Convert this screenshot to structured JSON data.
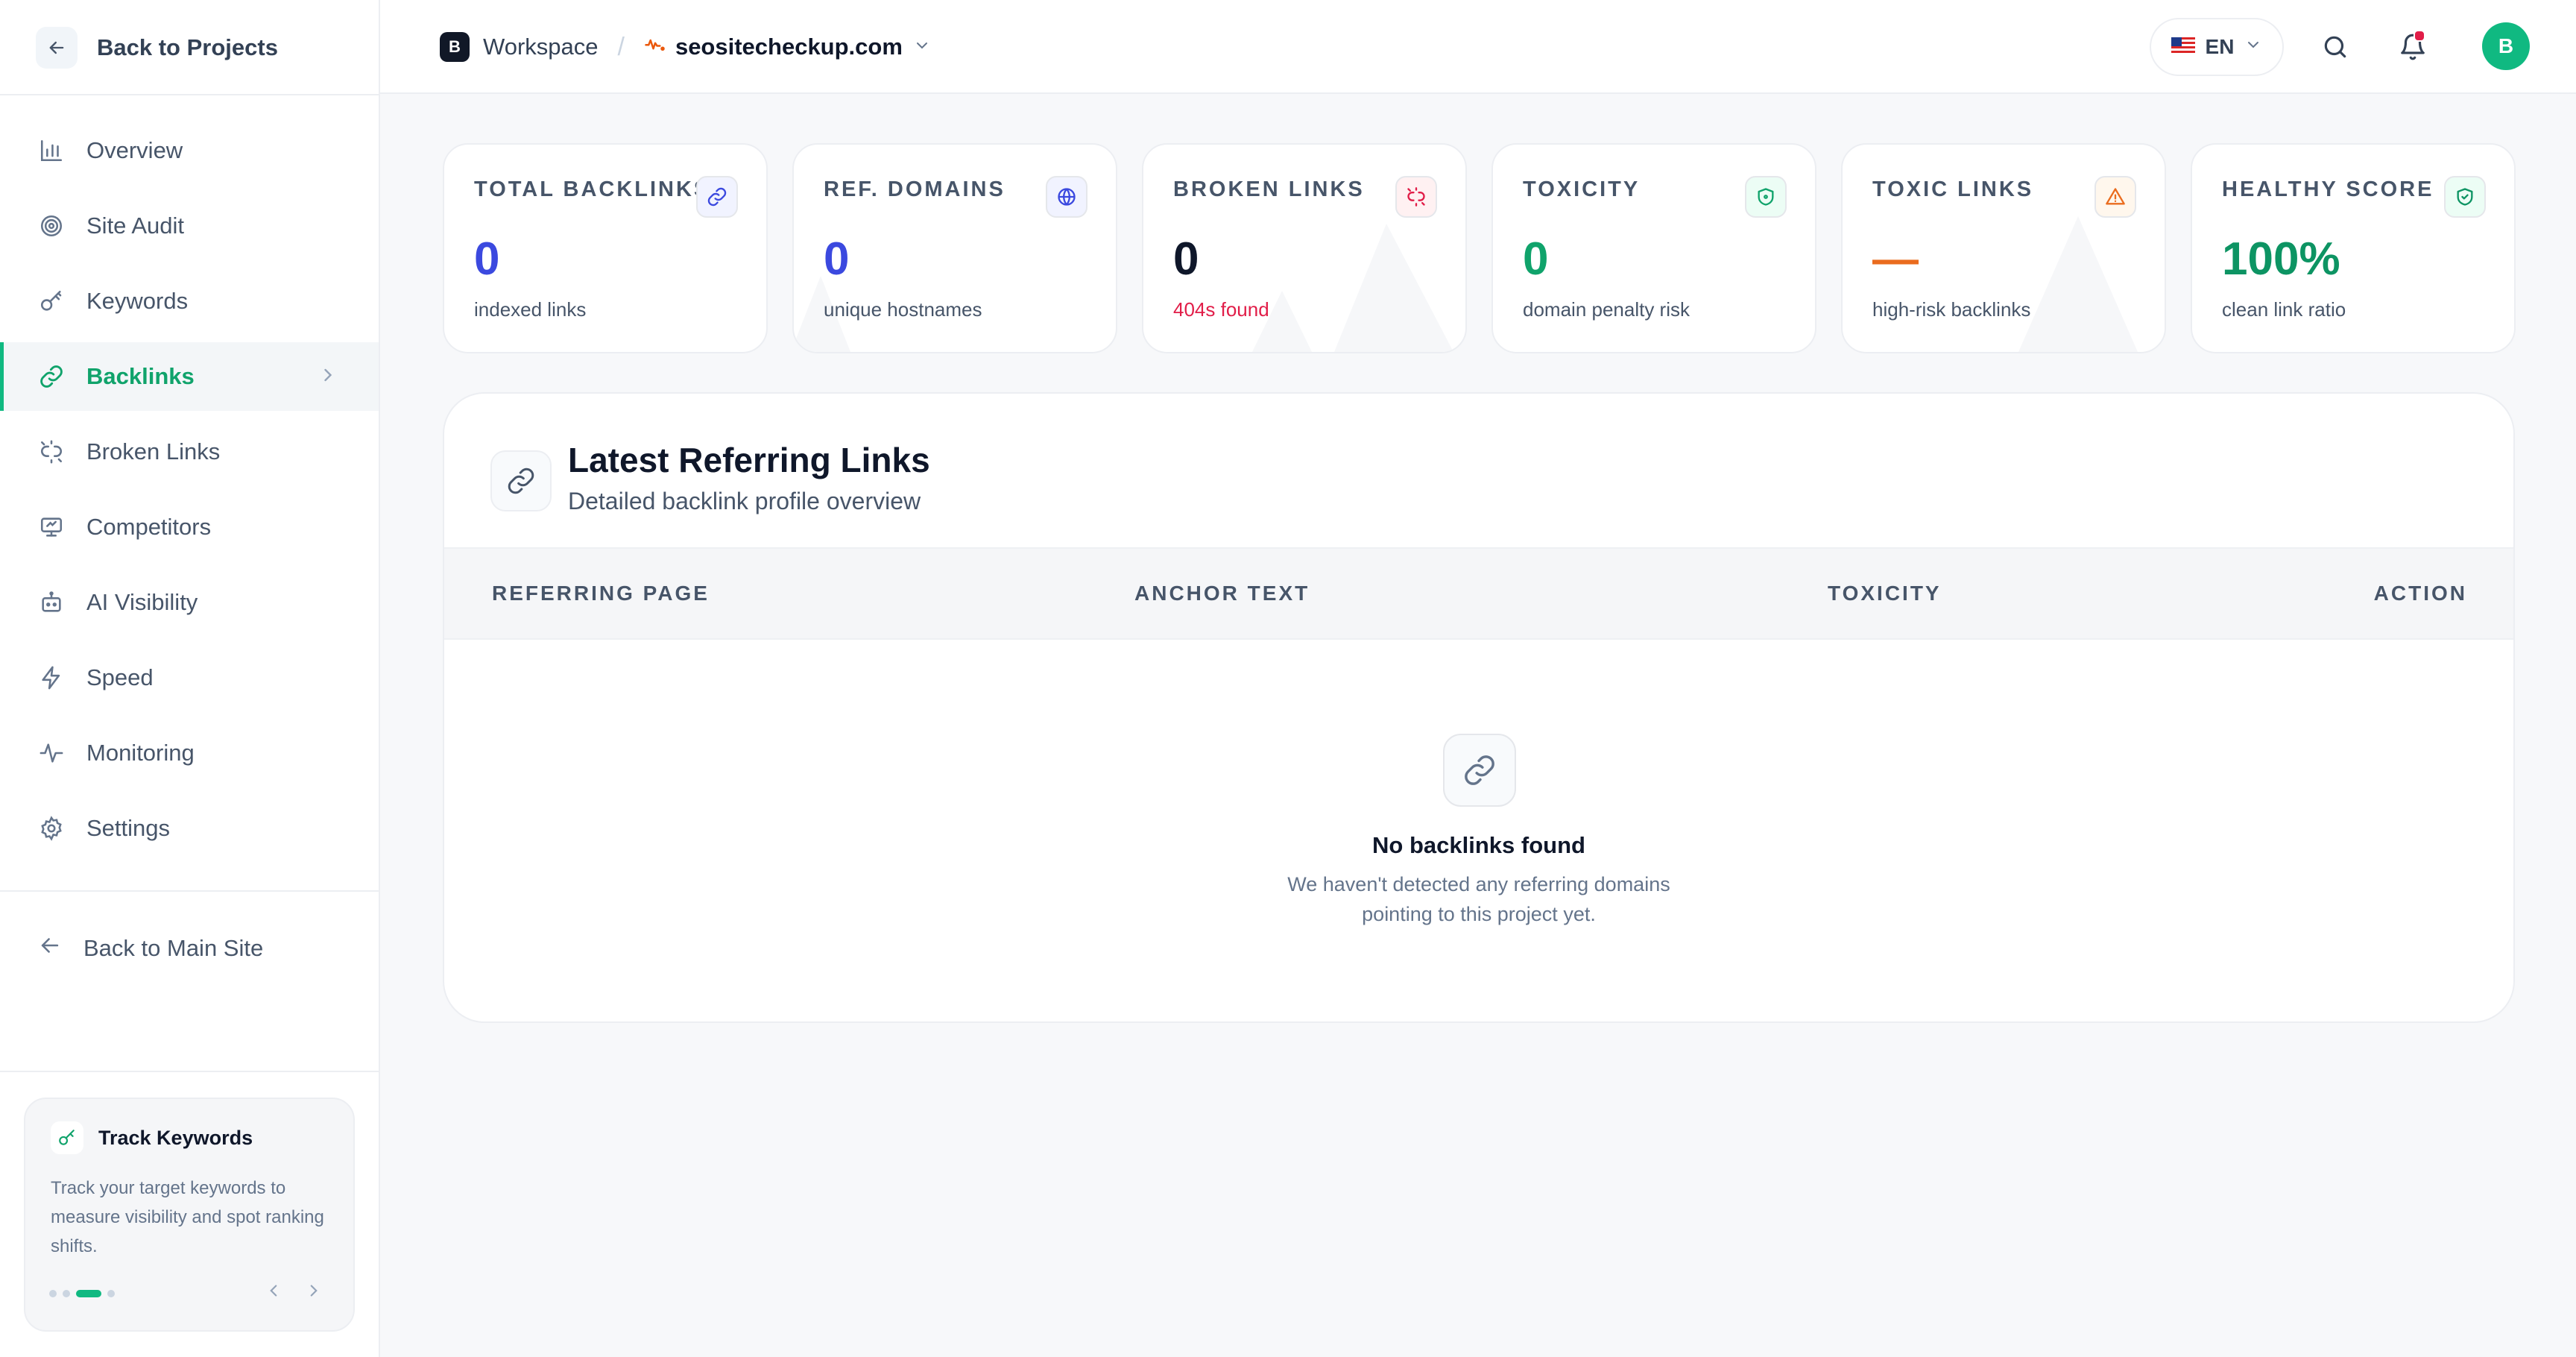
{
  "sidebar": {
    "back_label": "Back to Projects",
    "items": [
      {
        "label": "Overview",
        "icon": "bar-chart-icon"
      },
      {
        "label": "Site Audit",
        "icon": "target-icon"
      },
      {
        "label": "Keywords",
        "icon": "key-icon"
      },
      {
        "label": "Backlinks",
        "icon": "link-icon",
        "active": true
      },
      {
        "label": "Broken Links",
        "icon": "broken-link-icon"
      },
      {
        "label": "Competitors",
        "icon": "monitor-icon"
      },
      {
        "label": "AI Visibility",
        "icon": "robot-icon"
      },
      {
        "label": "Speed",
        "icon": "lightning-icon"
      },
      {
        "label": "Monitoring",
        "icon": "activity-icon"
      },
      {
        "label": "Settings",
        "icon": "gear-icon"
      }
    ],
    "back_main_label": "Back to Main Site",
    "promo": {
      "title": "Track Keywords",
      "text": "Track your target keywords to measure visibility and spot ranking shifts.",
      "slides": 4,
      "active_slide": 3
    }
  },
  "topbar": {
    "workspace_badge": "B",
    "workspace_label": "Workspace",
    "separator": "/",
    "site": "seositecheckup.com",
    "language": "EN",
    "avatar_initial": "B"
  },
  "stats": [
    {
      "label": "TOTAL BACKLINKS",
      "value": "0",
      "sub": "indexed links",
      "value_color": "#3b49df",
      "sub_color": "#475569",
      "icon": "link-icon"
    },
    {
      "label": "REF. DOMAINS",
      "value": "0",
      "sub": "unique hostnames",
      "value_color": "#3b49df",
      "sub_color": "#475569",
      "icon": "globe-icon"
    },
    {
      "label": "BROKEN LINKS",
      "value": "0",
      "sub": "404s found",
      "value_color": "#0f172a",
      "sub_color": "#e11d48",
      "icon": "broken-link-icon"
    },
    {
      "label": "TOXICITY",
      "value": "0",
      "sub": "domain penalty risk",
      "value_color": "#10a36b",
      "sub_color": "#475569",
      "icon": "shield-icon"
    },
    {
      "label": "TOXIC LINKS",
      "value": "—",
      "sub": "high-risk backlinks",
      "value_color": "#ea6c1e",
      "sub_color": "#475569",
      "icon": "warning-icon"
    },
    {
      "label": "HEALTHY SCORE",
      "value": "100%",
      "sub": "clean link ratio",
      "value_color": "#0d9463",
      "sub_color": "#475569",
      "icon": "shield-check-icon"
    }
  ],
  "panel": {
    "title": "Latest Referring Links",
    "subtitle": "Detailed backlink profile overview",
    "columns": [
      "REFERRING PAGE",
      "ANCHOR TEXT",
      "TOXICITY",
      "ACTION"
    ],
    "empty_title": "No backlinks found",
    "empty_desc": "We haven't detected any referring domains pointing to this project yet."
  }
}
